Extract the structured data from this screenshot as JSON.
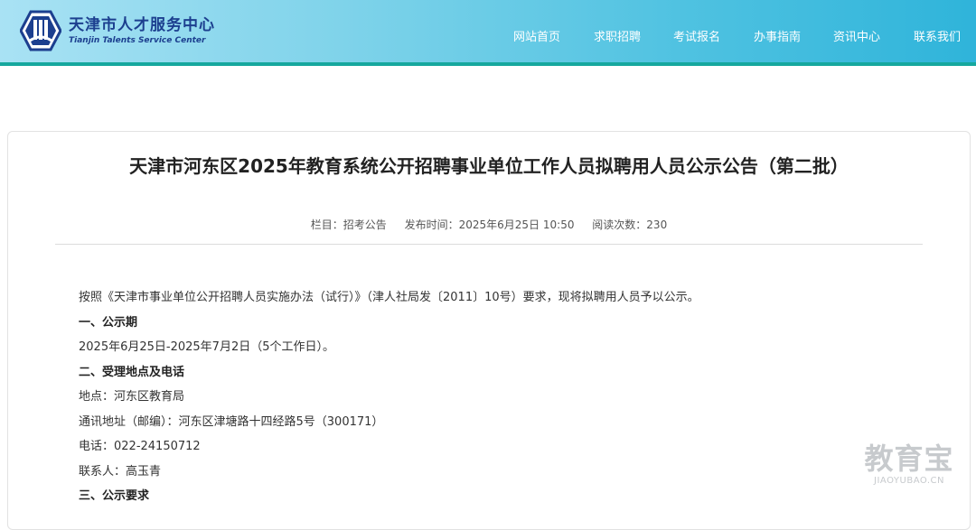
{
  "header": {
    "logo_title": "天津市人才服务中心",
    "logo_subtitle": "Tianjin Talents Service Center",
    "colors": {
      "brand": "#1c3f8f",
      "accent_bar": "#16a89e"
    },
    "nav": [
      {
        "label": "网站首页"
      },
      {
        "label": "求职招聘"
      },
      {
        "label": "考试报名"
      },
      {
        "label": "办事指南"
      },
      {
        "label": "资讯中心"
      },
      {
        "label": "联系我们"
      }
    ]
  },
  "article": {
    "title": "天津市河东区2025年教育系统公开招聘事业单位工作人员拟聘用人员公示公告（第二批）",
    "meta": {
      "column": "栏目：招考公告",
      "published": "发布时间：2025年6月25日 10:50",
      "views": "阅读次数：230"
    },
    "paragraphs": [
      "按照《天津市事业单位公开招聘人员实施办法（试行）》（津人社局发〔2011〕10号）要求，现将拟聘用人员予以公示。",
      "一、公示期",
      "2025年6月25日-2025年7月2日（5个工作日）。",
      "二、受理地点及电话",
      "地点：河东区教育局",
      "通讯地址（邮编）：河东区津塘路十四经路5号（300171）",
      "电话：022-24150712",
      "联系人：高玉青",
      "三、公示要求"
    ]
  },
  "watermark": {
    "main": "教育宝",
    "sub": "JIAOYUBAO.CN"
  }
}
